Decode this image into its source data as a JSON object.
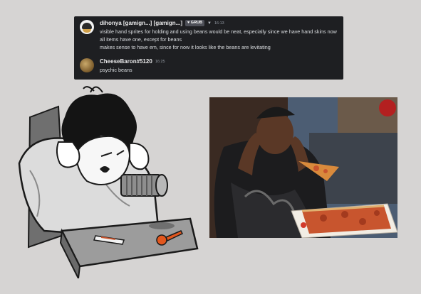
{
  "chat": {
    "messages": [
      {
        "username": "dihonya [gamign...] [gamign...]",
        "tag": "GRUB",
        "time": "16:13",
        "lines": [
          "visible hand sprites for holding and using beans would be neat, especially since we have hand skins now",
          "all items have one, except for beans",
          "makes sense to have em, since for now it looks like the beans are levitating"
        ]
      },
      {
        "username": "CheeseBaron#5120",
        "time": "16:25",
        "lines": [
          "psychic beans"
        ]
      }
    ]
  },
  "colors": {
    "background": "#d6d4d3",
    "chat_background": "#1e1f22",
    "pizza_box": "#f2ede4",
    "pizza_sauce": "#c8552e",
    "key_orange": "#e2571e"
  }
}
